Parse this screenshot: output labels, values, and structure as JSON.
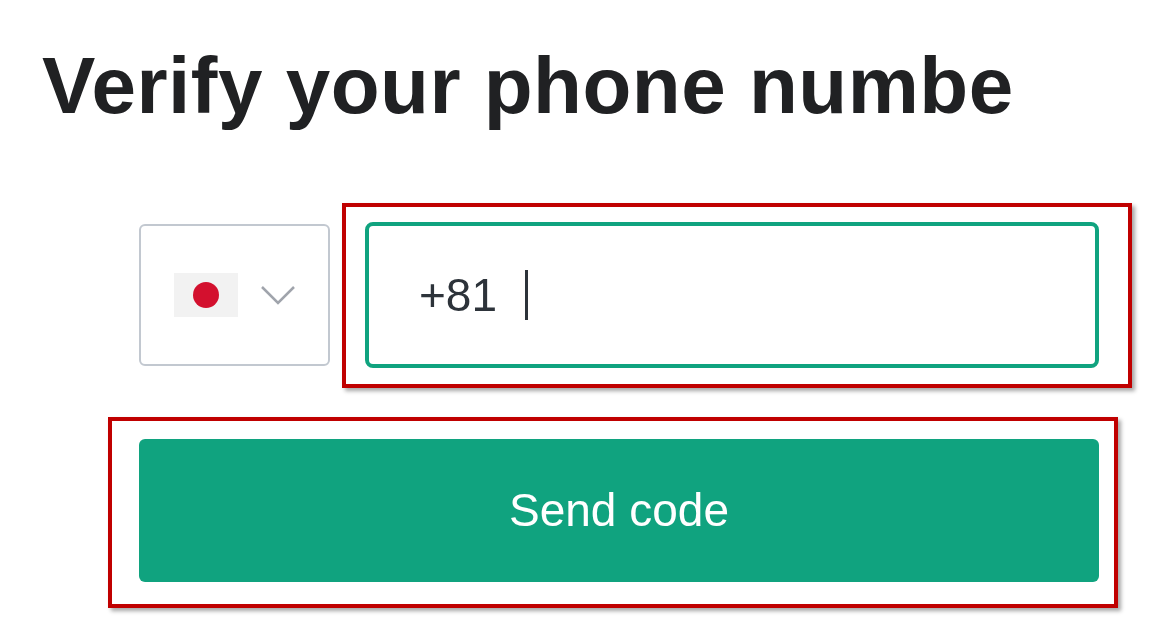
{
  "heading": "Verify your phone numbe",
  "country_select": {
    "expanded": false
  },
  "phone_field": {
    "value": "+81",
    "focused": true,
    "highlighted": true
  },
  "send_button": {
    "label": "Send code",
    "highlighted": true
  }
}
